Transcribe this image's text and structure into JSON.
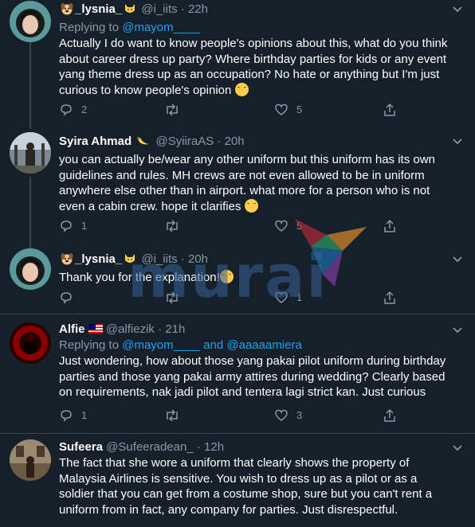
{
  "tweets": [
    {
      "name": "_lysnia_",
      "handle": "@i_iits",
      "time": "22h",
      "replying_prefix": "Replying to",
      "replying_to": [
        "@mayom____"
      ],
      "text": "Actually I do want to know people's opinions about this, what do you think about career dress up party? Where birthday parties for kids or any event yang theme dress up as an occupation? No hate or anything but I'm just curious to know people's opinion",
      "replies": "2",
      "retweets": "",
      "likes": "5",
      "avatar_icon": "profile-photo"
    },
    {
      "name": "Syira Ahmad",
      "handle": "@SyiiraAS",
      "time": "20h",
      "text": "you can actually be/wear any other uniform but this uniform has its own guidelines and rules. MH crews are not even allowed to be in uniform anywhere else other than in airport. what more for a person who is not even a cabin crew. hope it clarifies",
      "replies": "1",
      "retweets": "",
      "likes": "5",
      "avatar_icon": "profile-photo"
    },
    {
      "name": "_lysnia_",
      "handle": "@i_iits",
      "time": "20h",
      "text": "Thank you for the explanation!",
      "replies": "",
      "retweets": "",
      "likes": "1",
      "avatar_icon": "profile-photo"
    },
    {
      "name": "Alfie",
      "handle": "@alfiezik",
      "time": "21h",
      "replying_prefix": "Replying to",
      "replying_to": [
        "@mayom____",
        "@aaaaamiera"
      ],
      "replying_and": "and",
      "text": "Just wondering, how about those yang pakai pilot uniform during birthday parties and those yang pakai army attires during wedding? Clearly based on requirements, nak jadi pilot and tentera lagi strict kan. Just curious",
      "replies": "1",
      "retweets": "",
      "likes": "3",
      "avatar_icon": "profile-photo"
    },
    {
      "name": "Sufeera",
      "handle": "@Sufeeradean_",
      "time": "12h",
      "text": "The fact that she wore a uniform that clearly shows the property of Malaysia Airlines is sensitive. You wish to dress up as a pilot or as a soldier that you can get from a costume shop, sure but you can't rent a uniform from in fact, any company for parties. Just disrespectful.",
      "avatar_icon": "profile-photo"
    }
  ],
  "watermark": "murai",
  "colors": {
    "background": "#15202b",
    "text": "#ffffff",
    "secondary": "#8899a6",
    "link": "#1da1f2",
    "divider": "#38444d"
  }
}
